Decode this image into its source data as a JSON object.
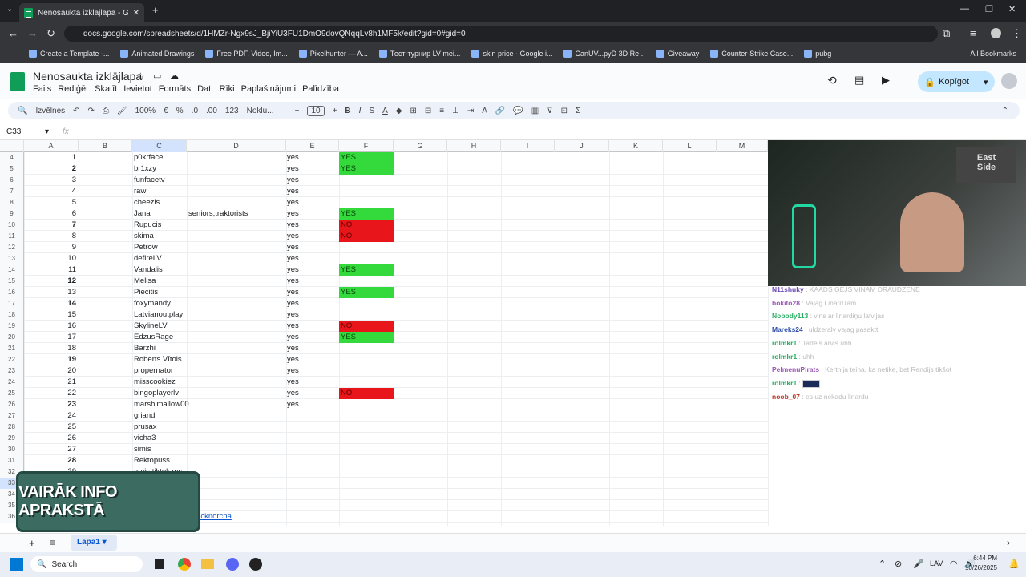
{
  "browser": {
    "tab_title": "Nenosaukta izklājlapa - Google",
    "url": "docs.google.com/spreadsheets/d/1HMZr-Ngx9sJ_BjiYiU3FU1DmO9dovQNqqLv8h1MF5k/edit?gid=0#gid=0",
    "bookmarks": [
      "Create a Template -...",
      "Animated Drawings",
      "Free PDF, Video, Im...",
      "Pixelhunter — A...",
      "Тест-турнир LV mei...",
      "skin price - Google i...",
      "CanUV...pyD 3D Re...",
      "Giveaway",
      "Counter-Strike Case...",
      "pubg"
    ],
    "all_bookmarks": "All Bookmarks"
  },
  "doc": {
    "title": "Nenosaukta izklājlapa",
    "menus": [
      "Fails",
      "Rediģēt",
      "Skatīt",
      "Ievietot",
      "Formāts",
      "Dati",
      "Rīki",
      "Paplašinājumi",
      "Palīdzība"
    ],
    "share_label": "Kopīgot"
  },
  "toolbar": {
    "menus": "Izvēlnes",
    "zoom": "100%",
    "currency": "€",
    "percent": "%",
    "dec_dec": ".0",
    "dec_inc": ".00",
    "format123": "123",
    "font": "Noklu...",
    "font_size": "10",
    "bold": "B",
    "italic": "I",
    "sum": "Σ"
  },
  "formula": {
    "cell_ref": "C33",
    "fx": "fx"
  },
  "columns": [
    "A",
    "B",
    "C",
    "D",
    "E",
    "F",
    "G",
    "H",
    "I",
    "J",
    "K",
    "L",
    "M"
  ],
  "rows": [
    {
      "rn": "4",
      "a": "1",
      "c": "p0krface",
      "e": "yes",
      "f": "YES",
      "fc": "#34d93b"
    },
    {
      "rn": "5",
      "a": "2",
      "c": "br1xzy",
      "e": "yes",
      "f": "YES",
      "fc": "#34d93b",
      "bold": true
    },
    {
      "rn": "6",
      "a": "3",
      "c": "funfacetv",
      "e": "yes"
    },
    {
      "rn": "7",
      "a": "4",
      "c": "raw",
      "e": "yes"
    },
    {
      "rn": "8",
      "a": "5",
      "c": "cheezis",
      "e": "yes"
    },
    {
      "rn": "9",
      "a": "6",
      "c": "Jana",
      "d": "seniors,traktorists",
      "e": "yes",
      "f": "YES",
      "fc": "#34d93b"
    },
    {
      "rn": "10",
      "a": "7",
      "c": "Rupucis",
      "e": "yes",
      "f": "NO",
      "fc": "#e8161a",
      "bold": true
    },
    {
      "rn": "11",
      "a": "8",
      "c": "skima",
      "e": "yes",
      "f": "NO",
      "fc": "#e8161a"
    },
    {
      "rn": "12",
      "a": "9",
      "c": "Petrow",
      "e": "yes"
    },
    {
      "rn": "13",
      "a": "10",
      "c": "defireLV",
      "e": "yes"
    },
    {
      "rn": "14",
      "a": "11",
      "c": "Vandalis",
      "e": "yes",
      "f": "YES",
      "fc": "#34d93b"
    },
    {
      "rn": "15",
      "a": "12",
      "c": "Melisa",
      "e": "yes",
      "bold": true
    },
    {
      "rn": "16",
      "a": "13",
      "c": "Piecitis",
      "e": "yes",
      "f": "YES",
      "fc": "#34d93b"
    },
    {
      "rn": "17",
      "a": "14",
      "c": "foxymandy",
      "e": "yes",
      "bold": true
    },
    {
      "rn": "18",
      "a": "15",
      "c": "Latvianoutplay",
      "e": "yes"
    },
    {
      "rn": "19",
      "a": "16",
      "c": "SkylineLV",
      "e": "yes",
      "f": "NO",
      "fc": "#e8161a"
    },
    {
      "rn": "20",
      "a": "17",
      "c": "EdzusRage",
      "e": "yes",
      "f": "YES",
      "fc": "#34d93b"
    },
    {
      "rn": "21",
      "a": "18",
      "c": "Barzhi",
      "e": "yes"
    },
    {
      "rn": "22",
      "a": "19",
      "c": "Roberts Vītols",
      "e": "yes",
      "bold": true
    },
    {
      "rn": "23",
      "a": "20",
      "c": "propernator",
      "e": "yes"
    },
    {
      "rn": "24",
      "a": "21",
      "c": "misscookiez",
      "e": "yes"
    },
    {
      "rn": "25",
      "a": "22",
      "c": "bingoplayerlv",
      "e": "yes",
      "f": "NO",
      "fc": "#e8161a"
    },
    {
      "rn": "26",
      "a": "23",
      "c": "marshimallow00",
      "e": "yes",
      "bold": true
    },
    {
      "rn": "27",
      "a": "24",
      "c": "griand"
    },
    {
      "rn": "28",
      "a": "25",
      "c": "prusax"
    },
    {
      "rn": "29",
      "a": "26",
      "c": "vicha3"
    },
    {
      "rn": "30",
      "a": "27",
      "c": "simis"
    },
    {
      "rn": "31",
      "a": "28",
      "c": "Rektopuss",
      "bold": true
    },
    {
      "rn": "32",
      "a": "29",
      "c": "arvis.tiktok.mc"
    },
    {
      "rn": "33",
      "a": "",
      "c": ""
    },
    {
      "rn": "34",
      "a": "",
      "c": ""
    },
    {
      "rn": "35",
      "a": "",
      "c": ""
    },
    {
      "rn": "36",
      "a": "",
      "c": "",
      "d": "chucknorcha"
    }
  ],
  "overlay": {
    "banner": "VAIRĀK INFO APRAKSTĀ",
    "chat": [
      {
        "user": "N11shuky",
        "msg": "KAADS GEJS VINAM DRAUDZENE",
        "color": "#6c4bb8"
      },
      {
        "user": "bokito28",
        "msg": "Vajag LinardTam",
        "color": "#9b59b6"
      },
      {
        "user": "Nobody113",
        "msg": "vins ar linardiņu latvijas",
        "color": "#27ae60"
      },
      {
        "user": "Mareks24",
        "msg": "uldzeralv vajag pasaktt",
        "color": "#2a4aa6"
      },
      {
        "user": "rolmkr1",
        "msg": "Tadeis arvis uhh",
        "color": "#27ae60"
      },
      {
        "user": "rolmkr1",
        "msg": "uhh",
        "color": "#27ae60"
      },
      {
        "user": "PelmenuPirats",
        "msg": "Kertnija teina, ka netike, bet Rendijs tikšot",
        "color": "#9b59b6"
      },
      {
        "user": "rolmkr1",
        "msg": "",
        "color": "#27ae60"
      },
      {
        "user": "noob_07",
        "msg": "es uz nekadu linardu",
        "color": "#c0392b"
      }
    ]
  },
  "sheet_tab": "Lapa1",
  "taskbar": {
    "search": "Search",
    "lang": "LAV",
    "time": "6:44 PM",
    "date": "10/26/2025"
  }
}
